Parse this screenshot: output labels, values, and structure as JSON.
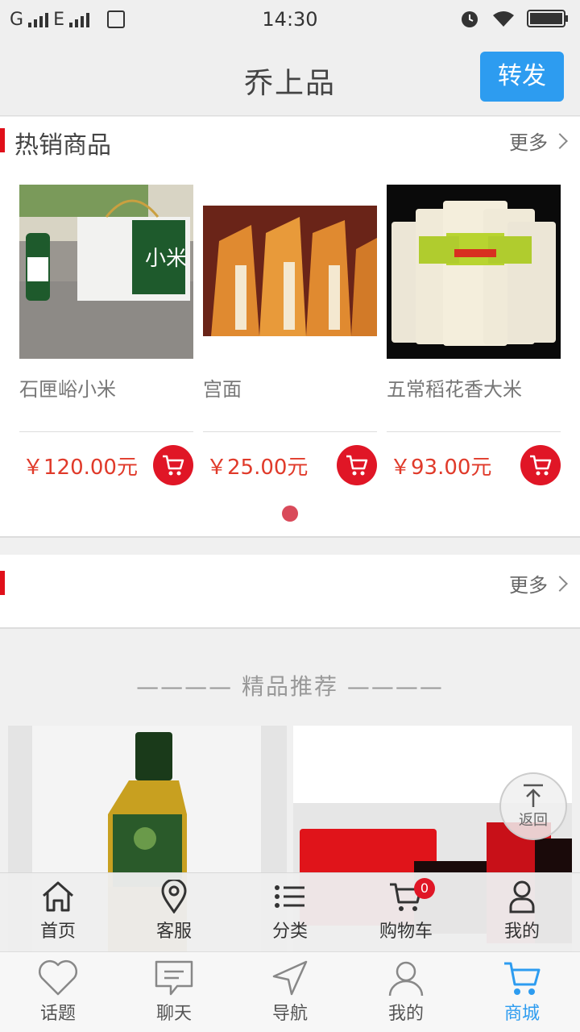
{
  "status_bar": {
    "carrier_left": "G",
    "network": "E",
    "time": "14:30"
  },
  "header": {
    "title": "乔上品",
    "share_label": "转发"
  },
  "hot_section": {
    "title": "热销商品",
    "more_label": "更多",
    "products": [
      {
        "name": "石匣峪小米",
        "price": "￥120.00元"
      },
      {
        "name": "宫面",
        "price": "￥25.00元"
      },
      {
        "name": "五常稻花香大米",
        "price": "￥93.00元"
      }
    ],
    "page_indicator": {
      "current": 1,
      "total": 1
    }
  },
  "second_section": {
    "title": "",
    "more_label": "更多"
  },
  "recommend": {
    "title": "———— 精品推荐 ————"
  },
  "back_to_top": {
    "label": "返回"
  },
  "shop_nav": {
    "items": [
      {
        "label": "首页",
        "icon": "home-icon"
      },
      {
        "label": "客服",
        "icon": "location-pin-icon"
      },
      {
        "label": "分类",
        "icon": "list-icon"
      },
      {
        "label": "购物车",
        "icon": "cart-icon",
        "badge": "0"
      },
      {
        "label": "我的",
        "icon": "person-icon"
      }
    ]
  },
  "tab_bar": {
    "items": [
      {
        "label": "话题",
        "icon": "heart-icon"
      },
      {
        "label": "聊天",
        "icon": "chat-icon"
      },
      {
        "label": "导航",
        "icon": "navigation-icon"
      },
      {
        "label": "我的",
        "icon": "person-icon"
      },
      {
        "label": "商城",
        "icon": "cart-icon",
        "active": true
      }
    ]
  },
  "colors": {
    "accent_blue": "#2d9cf0",
    "price_red": "#e03a2a",
    "cart_red": "#e01626",
    "section_mark_red": "#e0101a"
  }
}
